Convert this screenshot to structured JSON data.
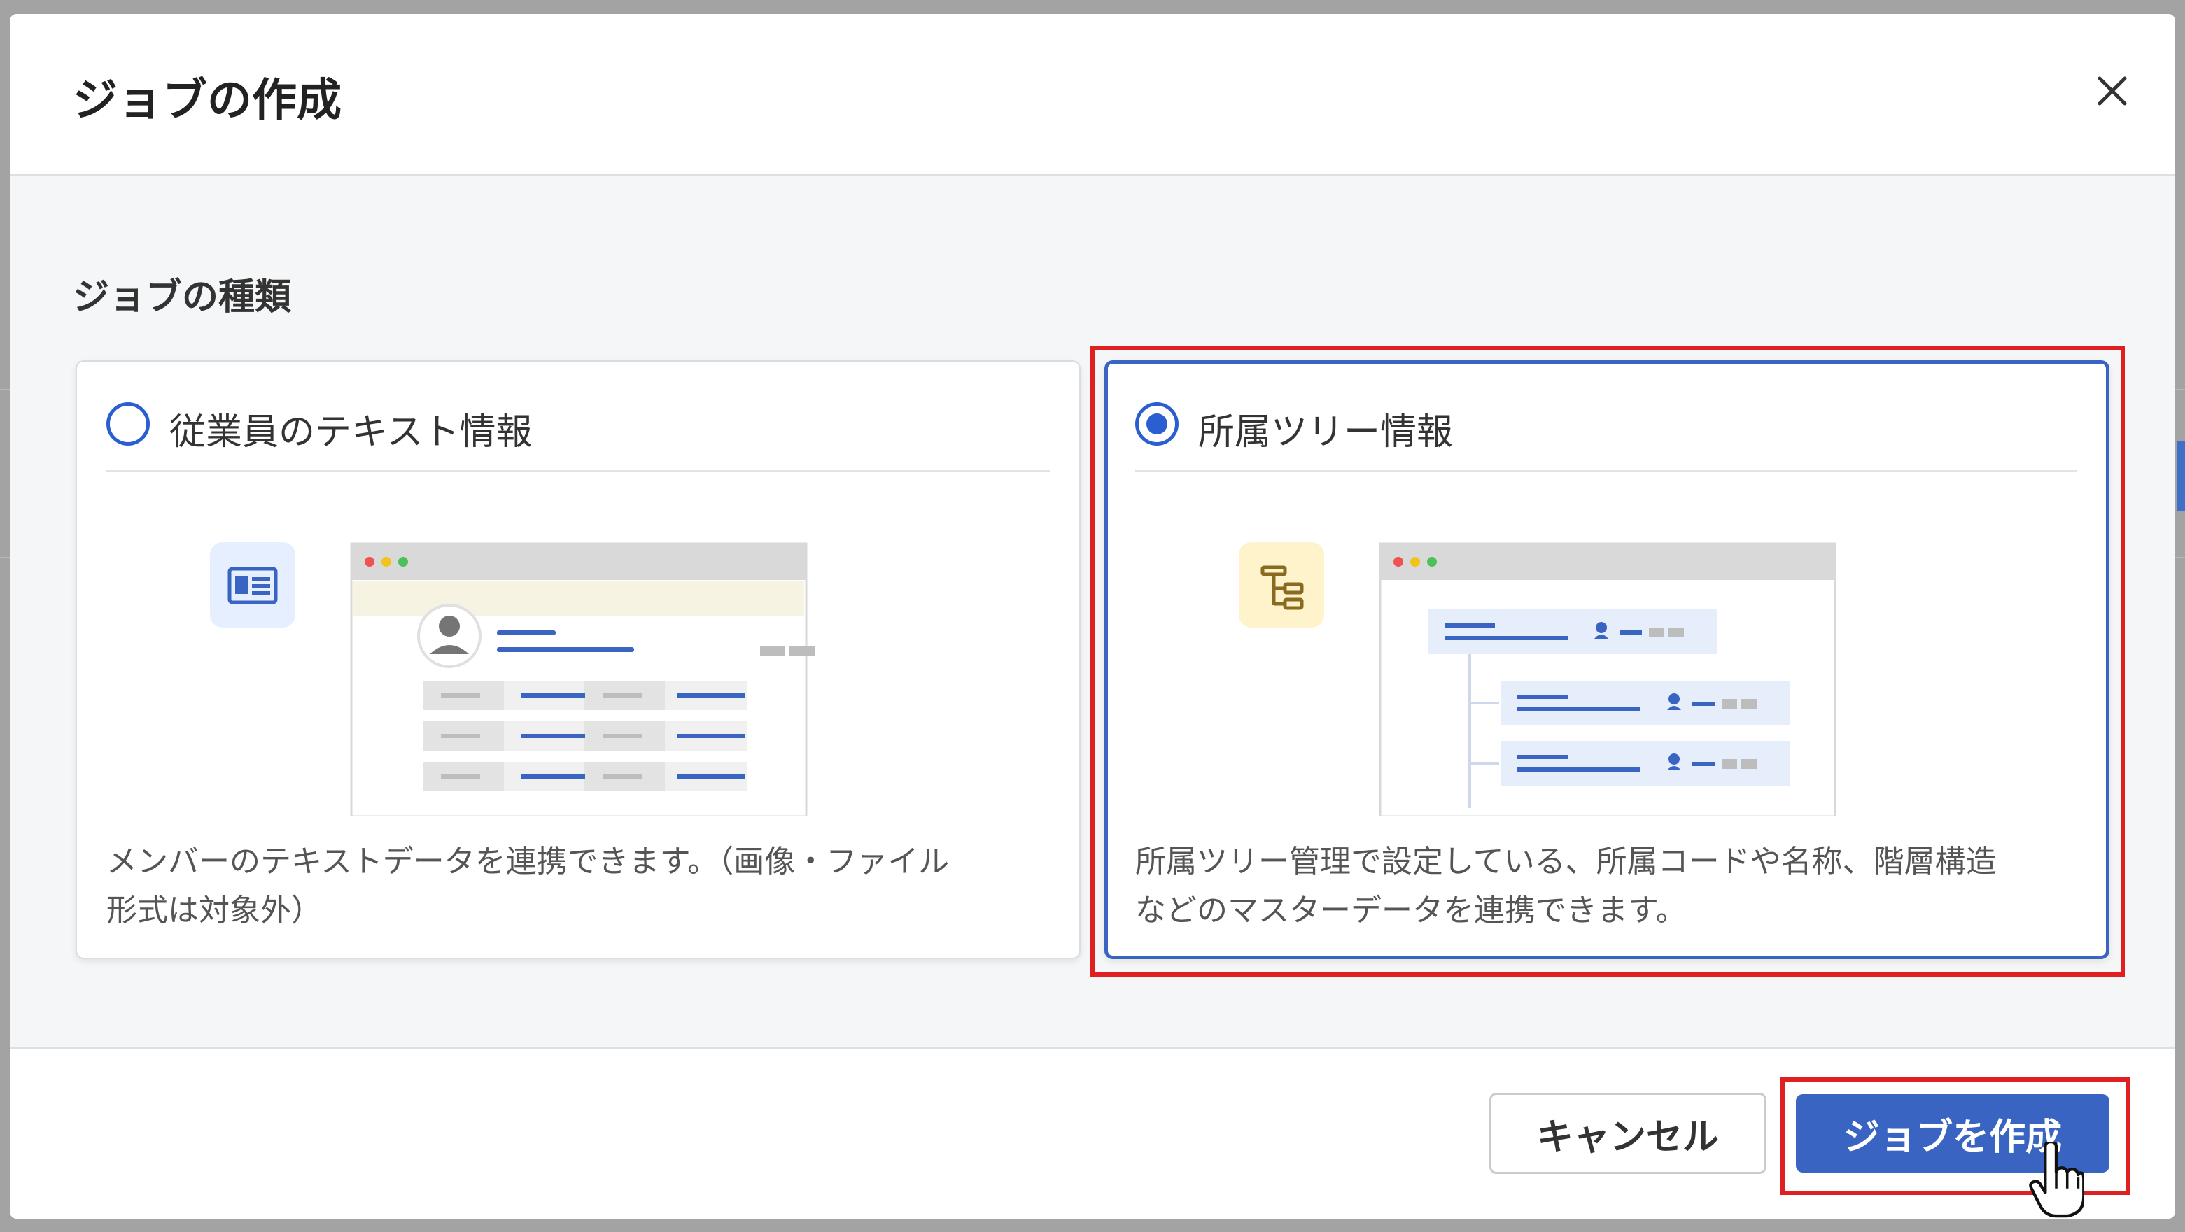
{
  "dialog": {
    "title": "ジョブの作成",
    "close_icon": "close-icon"
  },
  "section": {
    "label": "ジョブの種類"
  },
  "options": [
    {
      "title": "従業員のテキスト情報",
      "description_line1": "メンバーのテキストデータを連携できます。（画像・ファイル",
      "description_line2": "形式は対象外）",
      "selected": false,
      "icon": "id-card-icon"
    },
    {
      "title": "所属ツリー情報",
      "description_line1": "所属ツリー管理で設定している、所属コードや名称、階層構造",
      "description_line2": "などのマスターデータを連携できます。",
      "selected": true,
      "icon": "org-tree-icon"
    }
  ],
  "footer": {
    "cancel_label": "キャンセル",
    "create_label": "ジョブを作成"
  },
  "colors": {
    "accent": "#3a64c2",
    "highlight": "#e02020"
  }
}
